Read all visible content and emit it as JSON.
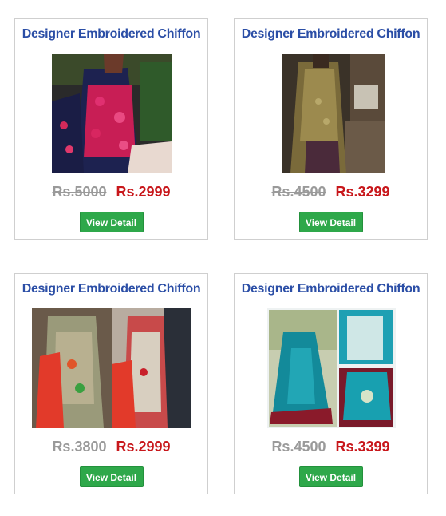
{
  "products": [
    {
      "title": "Designer Embroidered Chiffon",
      "old_price": "Rs.5000",
      "new_price": "Rs.2999",
      "button": "View Detail"
    },
    {
      "title": "Designer Embroidered Chiffon",
      "old_price": "Rs.4500",
      "new_price": "Rs.3299",
      "button": "View Detail"
    },
    {
      "title": "Designer Embroidered Chiffon",
      "old_price": "Rs.3800",
      "new_price": "Rs.2999",
      "button": "View Detail"
    },
    {
      "title": "Designer Embroidered Chiffon",
      "old_price": "Rs.4500",
      "new_price": "Rs.3399",
      "button": "View Detail"
    }
  ],
  "colors": {
    "title": "#2b4ea6",
    "old_price": "#9a9a9a",
    "new_price": "#c8171b",
    "button": "#2ea84a"
  }
}
